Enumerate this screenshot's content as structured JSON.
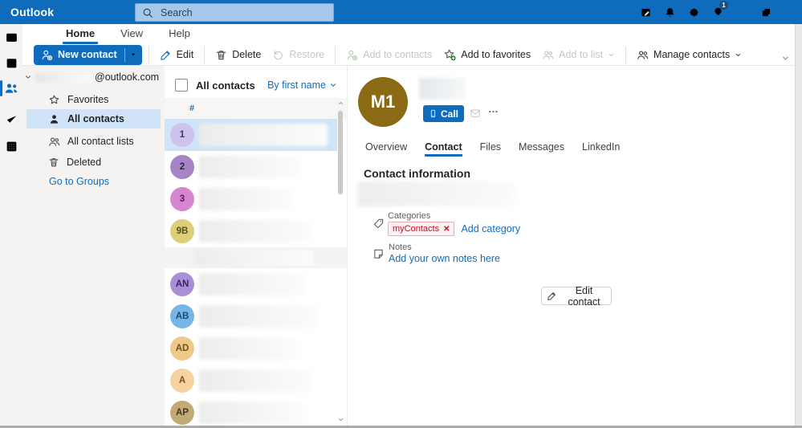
{
  "colors": {
    "accent": "#0f6cbd",
    "topbar_bg": "#0f6cbd",
    "selection_bg": "#cfe4f7",
    "tag_text": "#c50f1f",
    "tag_bg": "#fdf3f4",
    "tag_border": "#eeacb2"
  },
  "topbar": {
    "app_name": "Outlook",
    "search_placeholder": "Search",
    "tips_badge": "1",
    "icons": [
      "feedback-icon",
      "notifications-bell-icon",
      "settings-gear-icon",
      "tips-lightbulb-icon",
      "minimize-icon",
      "restore-window-icon",
      "close-icon"
    ]
  },
  "ribbon": {
    "tabs": [
      {
        "label": "Home",
        "active": true
      },
      {
        "label": "View",
        "active": false
      },
      {
        "label": "Help",
        "active": false
      }
    ],
    "buttons": {
      "new_contact": "New contact",
      "edit": "Edit",
      "delete": "Delete",
      "restore": "Restore",
      "add_to_contacts": "Add to contacts",
      "add_to_favorites": "Add to favorites",
      "add_to_list": "Add to list",
      "manage_contacts": "Manage contacts"
    }
  },
  "nav_rail": {
    "icons": [
      "mail-icon",
      "calendar-icon",
      "people-icon",
      "todo-check-icon",
      "apps-grid-icon"
    ],
    "active": "people-icon"
  },
  "sidebar": {
    "account_suffix": "@outlook.com",
    "items": [
      {
        "label": "Favorites",
        "selected": false
      },
      {
        "label": "All contacts",
        "selected": true
      },
      {
        "label": "All contact lists",
        "selected": false
      },
      {
        "label": "Deleted",
        "selected": false
      }
    ],
    "groups_link": "Go to Groups"
  },
  "contact_list": {
    "title": "All contacts",
    "sort_label": "By first name",
    "section_label": "#",
    "items": [
      {
        "initials": "1",
        "bg": "#cfc2ec",
        "fg": "#40356b",
        "selected": true
      },
      {
        "initials": "2",
        "bg": "#a684c6",
        "fg": "#33244a",
        "selected": false
      },
      {
        "initials": "3",
        "bg": "#d685cf",
        "fg": "#571f51",
        "selected": false
      },
      {
        "initials": "9B",
        "bg": "#ddce78",
        "fg": "#55501e",
        "selected": false
      },
      {
        "initials": "AN",
        "bg": "#a88fd8",
        "fg": "#362562",
        "selected": false
      },
      {
        "initials": "AB",
        "bg": "#76b5e8",
        "fg": "#1d4b70",
        "selected": false
      },
      {
        "initials": "AD",
        "bg": "#eec988",
        "fg": "#6d521c",
        "selected": false
      },
      {
        "initials": "A",
        "bg": "#f7d3a0",
        "fg": "#77541f",
        "selected": false
      },
      {
        "initials": "AP",
        "bg": "#c2aa76",
        "fg": "#453a17",
        "selected": false
      }
    ]
  },
  "detail": {
    "avatar": {
      "initials": "M1",
      "bg": "#8a6a15",
      "fg": "#ffffff"
    },
    "call_label": "Call",
    "more_label": "…",
    "tabs": [
      {
        "label": "Overview",
        "active": false
      },
      {
        "label": "Contact",
        "active": true
      },
      {
        "label": "Files",
        "active": false
      },
      {
        "label": "Messages",
        "active": false
      },
      {
        "label": "LinkedIn",
        "active": false
      }
    ],
    "section_title": "Contact information",
    "categories": {
      "label": "Categories",
      "tag": "myContacts",
      "remove_glyph": "✕",
      "add_link": "Add category"
    },
    "notes": {
      "label": "Notes",
      "add_link": "Add your own notes here"
    },
    "edit_button": "Edit contact"
  }
}
